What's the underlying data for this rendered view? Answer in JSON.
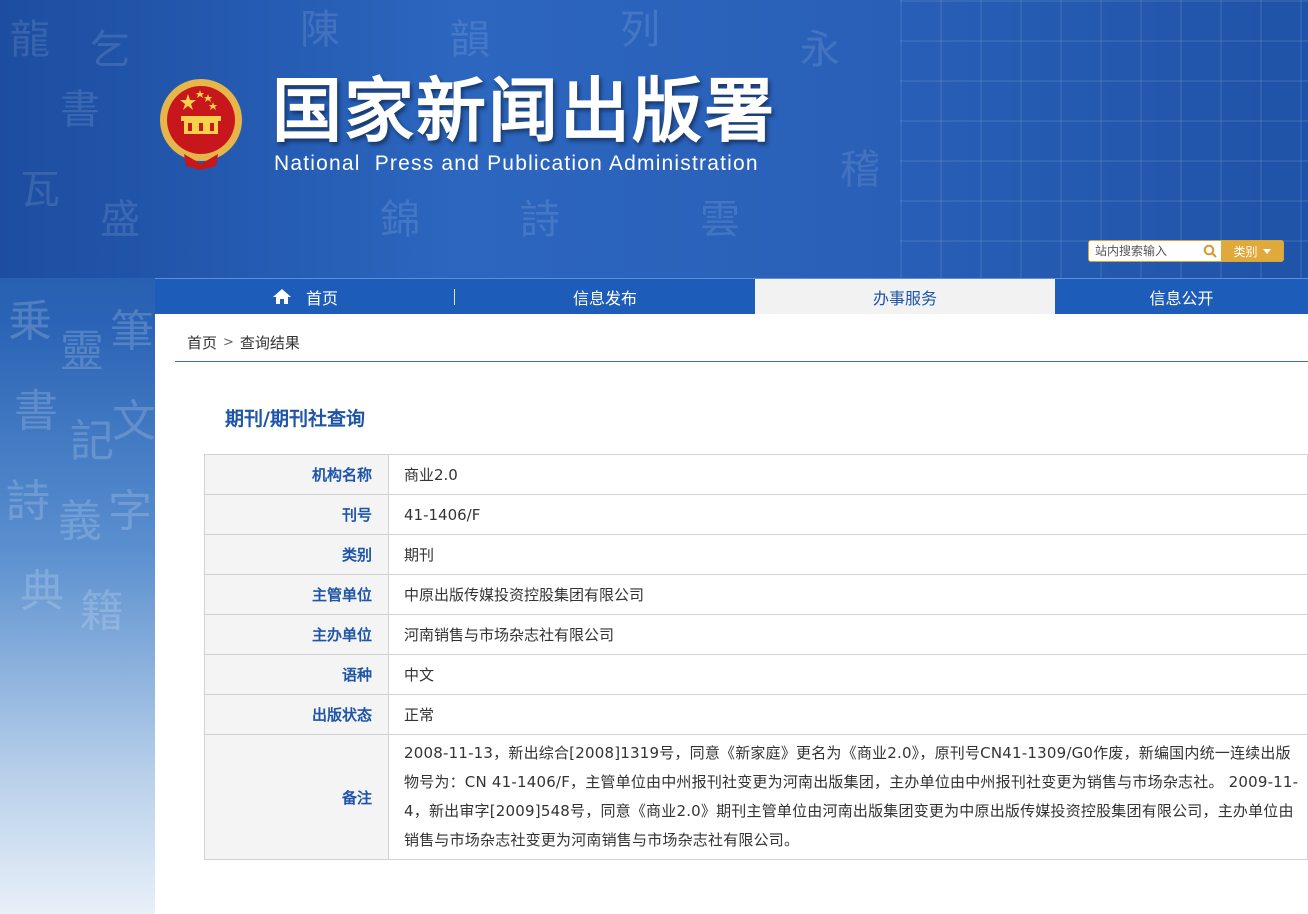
{
  "header": {
    "title": "国家新闻出版署",
    "subtitle": "National  Press and Publication Administration",
    "search_placeholder": "站内搜索输入",
    "category_label": "类别"
  },
  "nav": {
    "items": [
      {
        "label": "首页"
      },
      {
        "label": "信息发布"
      },
      {
        "label": "办事服务",
        "active": true
      },
      {
        "label": "信息公开"
      }
    ]
  },
  "breadcrumb": {
    "home": "首页",
    "separator": ">",
    "current": "查询结果"
  },
  "section_title": "期刊/期刊社查询",
  "table": {
    "rows": [
      {
        "label": "机构名称",
        "value": "商业2.0"
      },
      {
        "label": "刊号",
        "value": "41-1406/F"
      },
      {
        "label": "类别",
        "value": "期刊"
      },
      {
        "label": "主管单位",
        "value": "中原出版传媒投资控股集团有限公司"
      },
      {
        "label": "主办单位",
        "value": "河南销售与市场杂志社有限公司"
      },
      {
        "label": "语种",
        "value": "中文"
      },
      {
        "label": "出版状态",
        "value": "正常"
      }
    ],
    "note": {
      "label": "备注",
      "value": "2008-11-13，新出综合[2008]1319号，同意《新家庭》更名为《商业2.0》，原刊号CN41-1309/G0作废，新编国内统一连续出版物号为：CN 41-1406/F，主管单位由中州报刊社变更为河南出版集团，主办单位由中州报刊社变更为销售与市场杂志社。 2009-11-4，新出审字[2009]548号，同意《商业2.0》期刊主管单位由河南出版集团变更为中原出版传媒投资控股集团有限公司，主办单位由销售与市场杂志社变更为河南销售与市场杂志社有限公司。"
    }
  },
  "colors": {
    "header_blue": "#2a60b8",
    "nav_blue": "#1d5cb8",
    "accent_gold": "#e0a93b",
    "label_blue": "#1f55a8",
    "emblem_red": "#c8161d"
  },
  "icons": [
    "national-emblem-icon",
    "search-icon",
    "chevron-down-icon",
    "home-icon"
  ]
}
